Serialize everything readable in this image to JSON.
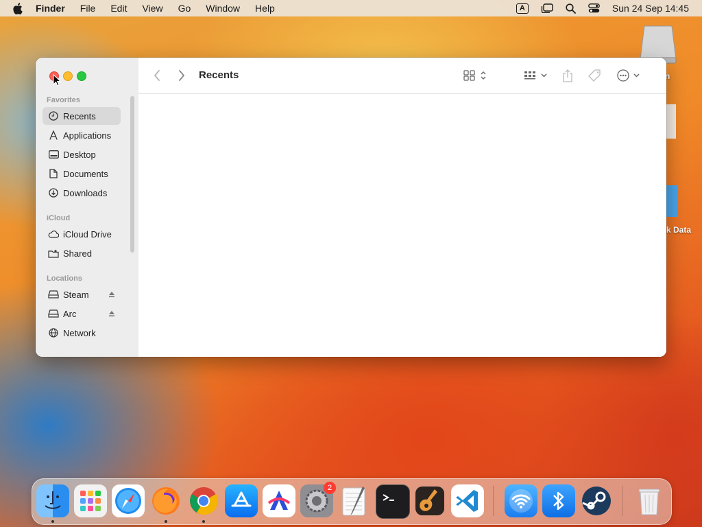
{
  "menubar": {
    "items": [
      "Finder",
      "File",
      "Edit",
      "View",
      "Go",
      "Window",
      "Help"
    ],
    "input_source": "A",
    "clock": "Sun 24 Sep  14:45"
  },
  "desktop": {
    "labels": [
      "n",
      "k Data"
    ]
  },
  "window": {
    "title": "Recents",
    "sidebar": {
      "favorites_title": "Favorites",
      "favorites": [
        {
          "label": "Recents",
          "icon": "clock-icon",
          "selected": true
        },
        {
          "label": "Applications",
          "icon": "applications-icon"
        },
        {
          "label": "Desktop",
          "icon": "desktop-icon"
        },
        {
          "label": "Documents",
          "icon": "document-icon"
        },
        {
          "label": "Downloads",
          "icon": "download-icon"
        }
      ],
      "icloud_title": "iCloud",
      "icloud": [
        {
          "label": "iCloud Drive",
          "icon": "cloud-icon"
        },
        {
          "label": "Shared",
          "icon": "shared-folder-icon"
        }
      ],
      "locations_title": "Locations",
      "locations": [
        {
          "label": "Steam",
          "icon": "drive-icon",
          "eject": true
        },
        {
          "label": "Arc",
          "icon": "drive-icon",
          "eject": true
        },
        {
          "label": "Network",
          "icon": "globe-icon"
        }
      ]
    }
  },
  "dock": {
    "apps": [
      "Finder",
      "Launchpad",
      "Safari",
      "Firefox",
      "Chrome",
      "App Store",
      "Affinity",
      "System Settings",
      "TextEdit",
      "Terminal",
      "GarageBand",
      "Visual Studio Code",
      "Wi-Fi",
      "Bluetooth",
      "Steam",
      "Trash"
    ],
    "settings_badge": "2"
  }
}
